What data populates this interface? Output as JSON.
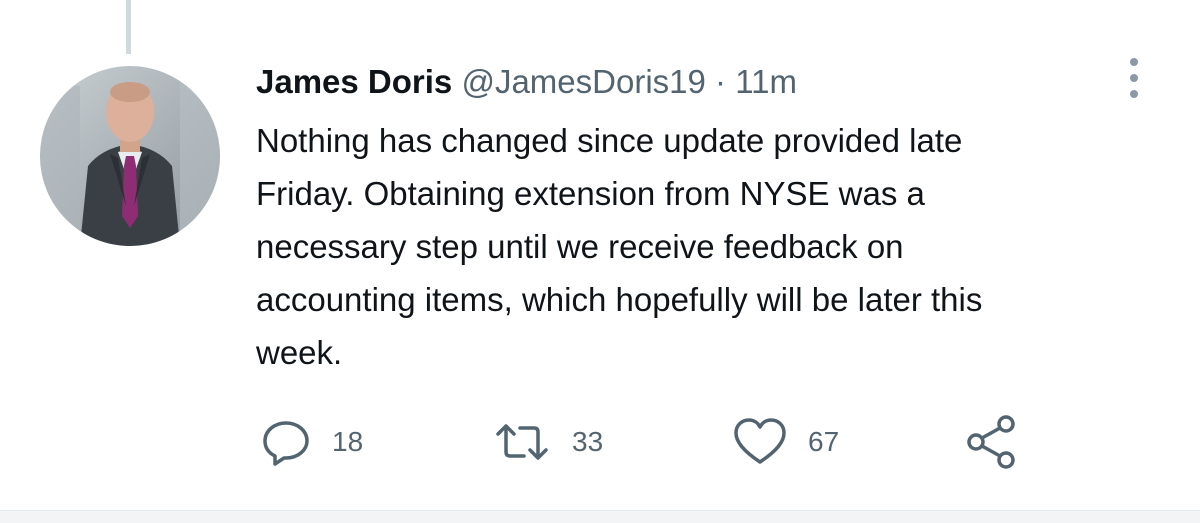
{
  "tweet": {
    "author_name": "James Doris",
    "handle": "@JamesDoris19",
    "separator": "·",
    "time": "11m",
    "text": "Nothing has changed since update provided late\nFriday.  Obtaining extension from NYSE was a\nnecessary step until we receive feedback on\naccounting items, which hopefully will be later this\nweek.",
    "icons": {
      "reply": "reply-icon",
      "retweet": "retweet-icon",
      "like": "heart-icon",
      "share": "share-icon",
      "more": "more-vertical-icon"
    },
    "counts": {
      "replies": "18",
      "retweets": "33",
      "likes": "67"
    }
  },
  "colors": {
    "text_primary": "#0f1419",
    "text_secondary": "#536471",
    "thread_line": "#cfd9de"
  }
}
